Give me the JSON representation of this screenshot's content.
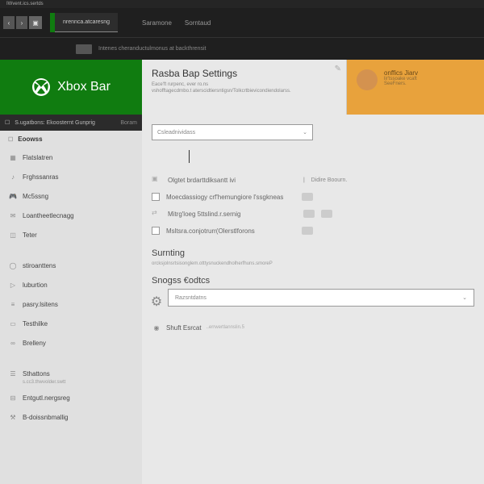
{
  "titlebar": {
    "text": "IWvent.ics.sertds"
  },
  "topbar": {
    "tab_active": "nrennca.atcaresng",
    "items": [
      "Saramone",
      "Sorntaud"
    ]
  },
  "subbar": {
    "text": "Intenes cheranductulmonus at backthrensit"
  },
  "brand": {
    "text": "Xbox Bar"
  },
  "breadcrumb": {
    "square": "☐",
    "path": "S.ugatbons: Ekoosternt Gunprig",
    "end": "Boram"
  },
  "sidebar": {
    "header": "Eoowss",
    "items": [
      {
        "icon": "layout",
        "label": "Flatslatren"
      },
      {
        "icon": "music",
        "label": "Frghssanras"
      },
      {
        "icon": "gamepad",
        "label": "Mc5ssng"
      },
      {
        "icon": "message",
        "label": "Loantheetlecnagg"
      },
      {
        "icon": "cube",
        "label": "Teter"
      },
      {
        "icon": "circle",
        "label": "stiroanttens"
      },
      {
        "icon": "play",
        "label": "luburtion"
      },
      {
        "icon": "lines",
        "label": "pasry.lsitens"
      },
      {
        "icon": "id",
        "label": "Testhilke"
      },
      {
        "icon": "link",
        "label": "Brelleny"
      },
      {
        "icon": "list",
        "label": "Sthattons",
        "sub": "s.cc3.thwvolder.swtt"
      },
      {
        "icon": "slider",
        "label": "Entgutl.nergsreg"
      },
      {
        "icon": "build",
        "label": "B-doissnbmallig"
      }
    ]
  },
  "settings": {
    "title": "Rasba Bap Settings",
    "desc1": "Eace'ft rurpenc, ever  ro.ns",
    "desc2": "vshofftagecdrnbo.t aterscidtiersntigsn/Tolkcrtbievicondiendolarss."
  },
  "orange": {
    "title": "onffics Jiarv",
    "sub": "lir'tssoake vcaft\nSeeFners."
  },
  "dropdown1": {
    "value": "Csleadnividass"
  },
  "options": [
    {
      "icon": "folder",
      "label": "Olgtet brdarttdiksantt ivi",
      "right": "Didire Boourn."
    },
    {
      "type": "check",
      "label": "Moecdassiogy crf'hemungiore l'ssgkneas",
      "badges": 1
    },
    {
      "icon": "arrows",
      "label": "Mitrg'loeg 5ttslind.r.sernig",
      "badges": 2
    },
    {
      "type": "check",
      "label": "Msltsra.conjotrurr(Olerstlforons",
      "badges": 1
    }
  ],
  "sections": {
    "summing": {
      "title": "Surnting",
      "desc": "orcksjolnsrtsisonglem.otttysnuckendholherfhuns.smoreP"
    },
    "storage": {
      "title": "Snogss €odtcs",
      "dropdown": "Razsntdatns"
    },
    "shut": {
      "label": "Shuft Esrcat",
      "desc": "..errwertlannslin.5"
    }
  }
}
